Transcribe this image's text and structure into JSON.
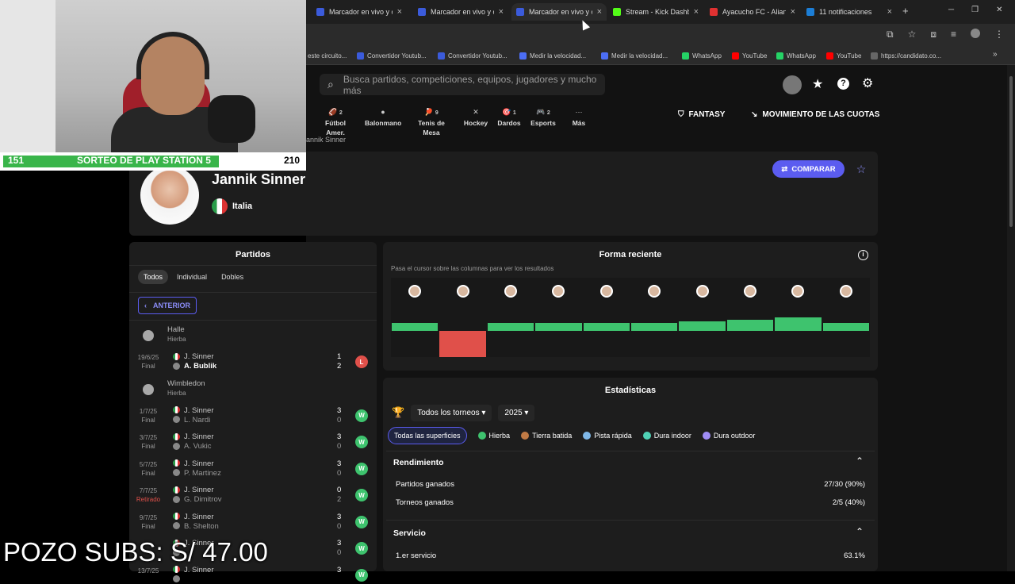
{
  "browser": {
    "tabs": [
      {
        "label": "Marcador en vivo y c",
        "color": "#3b5bdb"
      },
      {
        "label": "Marcador en vivo y c",
        "color": "#3b5bdb"
      },
      {
        "label": "Marcador en vivo y c",
        "color": "#3b5bdb"
      },
      {
        "label": "Stream - Kick Dashb",
        "color": "#53fc18"
      },
      {
        "label": "Ayacucho FC - Alianz",
        "color": "#e03131"
      },
      {
        "label": "11 notificaciones",
        "color": "#1c7ed6"
      }
    ],
    "new_tab": "+",
    "bookmarks": [
      {
        "label": "este circuito...",
        "color": "#888888"
      },
      {
        "label": "Convertidor Youtub...",
        "color": "#3b5bdb"
      },
      {
        "label": "Convertidor Youtub...",
        "color": "#3b5bdb"
      },
      {
        "label": "Medir la velocidad...",
        "color": "#4c6ef5"
      },
      {
        "label": "Medir la velocidad...",
        "color": "#4c6ef5"
      },
      {
        "label": "WhatsApp",
        "color": "#25d366"
      },
      {
        "label": "YouTube",
        "color": "#ff0000"
      },
      {
        "label": "WhatsApp",
        "color": "#25d366"
      },
      {
        "label": "YouTube",
        "color": "#ff0000"
      },
      {
        "label": "https://candidato.co...",
        "color": "#666666"
      }
    ]
  },
  "site": {
    "search_placeholder": "Busca partidos, competiciones, equipos, jugadores y mucho más",
    "sports": [
      {
        "count": "2",
        "label": "Fútbol Amer."
      },
      {
        "count": "",
        "label": "Balonmano"
      },
      {
        "count": "9",
        "label": "Tenis de Mesa"
      },
      {
        "count": "",
        "label": "Hockey"
      },
      {
        "count": "1",
        "label": "Dardos"
      },
      {
        "count": "2",
        "label": "Esports"
      },
      {
        "count": "",
        "label": "Más"
      }
    ],
    "fantasy": "FANTASY",
    "odds": "MOVIMIENTO DE LAS CUOTAS",
    "breadcrumb": "annik Sinner"
  },
  "player": {
    "name": "Jannik Sinner",
    "country": "Italia",
    "compare": "COMPARAR"
  },
  "matches": {
    "title": "Partidos",
    "filters": [
      "Todos",
      "Individual",
      "Dobles"
    ],
    "prev": "ANTERIOR",
    "rows": [
      {
        "type": "tournament",
        "name": "Halle",
        "surface": "Hierba"
      },
      {
        "type": "match",
        "date": "19/6/25",
        "status": "Final",
        "p1": "J. Sinner",
        "p2": "A. Bublik",
        "s1": "1",
        "s2": "2",
        "res": "L"
      },
      {
        "type": "tournament",
        "name": "Wimbledon",
        "surface": "Hierba"
      },
      {
        "type": "match",
        "date": "1/7/25",
        "status": "Final",
        "p1": "J. Sinner",
        "p2": "L. Nardi",
        "s1": "3",
        "s2": "0",
        "res": "W"
      },
      {
        "type": "match",
        "date": "3/7/25",
        "status": "Final",
        "p1": "J. Sinner",
        "p2": "A. Vukic",
        "s1": "3",
        "s2": "0",
        "res": "W"
      },
      {
        "type": "match",
        "date": "5/7/25",
        "status": "Final",
        "p1": "J. Sinner",
        "p2": "P. Martinez",
        "s1": "3",
        "s2": "0",
        "res": "W"
      },
      {
        "type": "match",
        "date": "7/7/25",
        "status": "Retirado",
        "p1": "J. Sinner",
        "p2": "G. Dimitrov",
        "s1": "0",
        "s2": "2",
        "res": "W"
      },
      {
        "type": "match",
        "date": "9/7/25",
        "status": "Final",
        "p1": "J. Sinner",
        "p2": "B. Shelton",
        "s1": "3",
        "s2": "0",
        "res": "W"
      },
      {
        "type": "match",
        "date": "",
        "status": "",
        "p1": "J. Sinner",
        "p2": "",
        "s1": "3",
        "s2": "0",
        "res": "W"
      },
      {
        "type": "match",
        "date": "13/7/25",
        "status": "",
        "p1": "J. Sinner",
        "p2": "",
        "s1": "3",
        "s2": "",
        "res": "W"
      }
    ]
  },
  "form": {
    "title": "Forma reciente",
    "hint": "Pasa el cursor sobre las columnas para ver los resultados",
    "results": [
      {
        "r": "W",
        "level": 0.3
      },
      {
        "r": "L",
        "level": 1.0
      },
      {
        "r": "W",
        "level": 0.3
      },
      {
        "r": "W",
        "level": 0.3
      },
      {
        "r": "W",
        "level": 0.3
      },
      {
        "r": "W",
        "level": 0.3
      },
      {
        "r": "W",
        "level": 0.36
      },
      {
        "r": "W",
        "level": 0.42
      },
      {
        "r": "W",
        "level": 0.52
      },
      {
        "r": "W",
        "level": 0.3
      }
    ],
    "win_color": "#3ec36e",
    "loss_color": "#e0504a"
  },
  "stats": {
    "title": "Estadísticas",
    "tournament_filter": "Todos los torneos",
    "year_filter": "2025",
    "surfaces": [
      {
        "label": "Todas las superficies",
        "color": ""
      },
      {
        "label": "Hierba",
        "color": "#3ec36e"
      },
      {
        "label": "Tierra batida",
        "color": "#c07a45"
      },
      {
        "label": "Pista rápida",
        "color": "#7fb8e8"
      },
      {
        "label": "Dura indoor",
        "color": "#4fd1b5"
      },
      {
        "label": "Dura outdoor",
        "color": "#9f8cf5"
      }
    ],
    "rendimiento": {
      "title": "Rendimiento",
      "rows": [
        {
          "label": "Partidos ganados",
          "value": "27/30 (90%)"
        },
        {
          "label": "Torneos ganados",
          "value": "2/5 (40%)"
        }
      ]
    },
    "servicio": {
      "title": "Servicio",
      "rows": [
        {
          "label": "1.er servicio",
          "value": "63.1%"
        }
      ]
    }
  },
  "stream": {
    "left_count": "151",
    "banner": "SORTEO DE PLAY STATION 5",
    "right_count": "210",
    "progress": 0.72,
    "pozo": "POZO SUBS: S/ 47.00"
  }
}
